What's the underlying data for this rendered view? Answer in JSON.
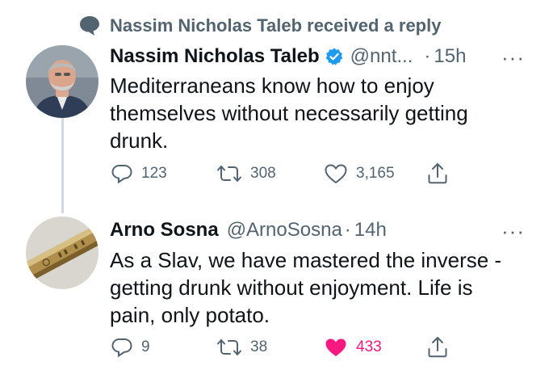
{
  "context": {
    "text": "Nassim Nicholas Taleb received a reply",
    "icon": "speech-bubble-icon"
  },
  "tweets": [
    {
      "author_name": "Nassim Nicholas Taleb",
      "handle": "@nnt...",
      "separator": "·",
      "time": "15h",
      "verified": true,
      "text_lines": [
        "Mediterraneans know how to enjoy",
        "themselves without necessarily getting",
        "drunk."
      ],
      "replies": "123",
      "retweets": "308",
      "likes": "3,165",
      "liked": false
    },
    {
      "author_name": "Arno Sosna",
      "handle": "@ArnoSosna",
      "separator": "·",
      "time": "14h",
      "verified": false,
      "text_lines": [
        "As a Slav, we have mastered the inverse -",
        "getting drunk without enjoyment. Life is",
        "pain, only potato."
      ],
      "replies": "9",
      "retweets": "38",
      "likes": "433",
      "liked": true
    }
  ],
  "more_label": "···",
  "colors": {
    "text": "#0f1419",
    "secondary": "#536471",
    "verified": "#1d9bf0",
    "like": "#f91880",
    "thread": "#cfd9de"
  }
}
